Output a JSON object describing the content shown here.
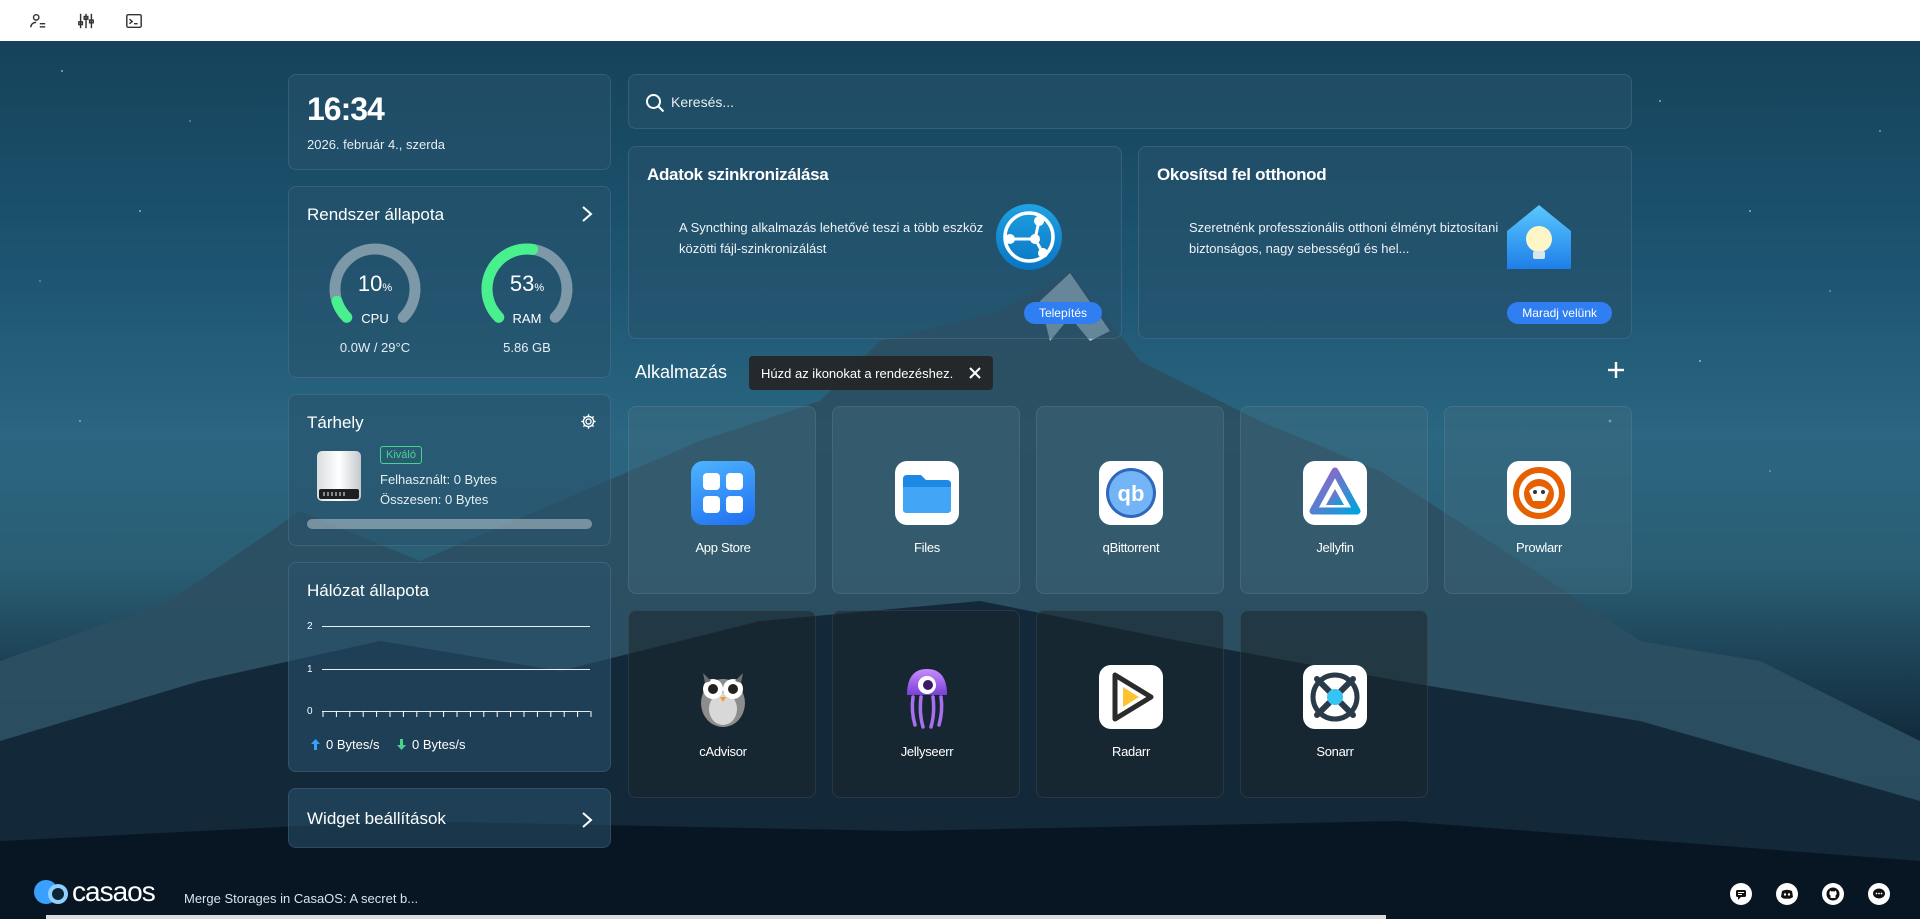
{
  "toolbar": {
    "icons": [
      "user-list-icon",
      "sliders-icon",
      "terminal-icon"
    ]
  },
  "clock": {
    "time": "16:34",
    "date": "2026. február 4., szerda"
  },
  "system": {
    "title": "Rendszer állapota",
    "cpu": {
      "value": "10",
      "unit": "%",
      "label": "CPU",
      "sub": "0.0W / 29°C",
      "percent": 10,
      "color": "#48f08e"
    },
    "ram": {
      "value": "53",
      "unit": "%",
      "label": "RAM",
      "sub": "5.86 GB",
      "percent": 53,
      "color": "#48f08e"
    }
  },
  "storage": {
    "title": "Tárhely",
    "badge": "Kiváló",
    "used": "Felhasznált: 0 Bytes",
    "total": "Összesen: 0 Bytes",
    "used_fraction": 0
  },
  "network": {
    "title": "Hálózat állapota",
    "y_ticks": [
      "2",
      "1",
      "0"
    ],
    "up": "0 Bytes/s",
    "down": "0 Bytes/s"
  },
  "widget_settings": {
    "title": "Widget beállítások"
  },
  "search": {
    "placeholder": "Keresés..."
  },
  "promos": [
    {
      "title": "Adatok szinkronizálása",
      "text": "A Syncthing alkalmazás lehetővé teszi a több eszköz közötti fájl-szinkronizálást",
      "button": "Telepítés",
      "icon": "syncthing-icon"
    },
    {
      "title": "Okosítsd fel otthonod",
      "text": "Szeretnénk professzionális otthoni élményt biztosítani biztonságos, nagy sebességű és hel...",
      "button": "Maradj velünk",
      "icon": "smart-home-icon"
    }
  ],
  "apps_section": {
    "title": "Alkalmazás",
    "tooltip": "Húzd az ikonokat a rendezéshez."
  },
  "apps": [
    {
      "name": "App Store",
      "icon": "app-store-icon"
    },
    {
      "name": "Files",
      "icon": "files-icon"
    },
    {
      "name": "qBittorrent",
      "icon": "qbittorrent-icon"
    },
    {
      "name": "Jellyfin",
      "icon": "jellyfin-icon"
    },
    {
      "name": "Prowlarr",
      "icon": "prowlarr-icon"
    },
    {
      "name": "cAdvisor",
      "icon": "cadvisor-icon"
    },
    {
      "name": "Jellyseerr",
      "icon": "jellyseerr-icon"
    },
    {
      "name": "Radarr",
      "icon": "radarr-icon"
    },
    {
      "name": "Sonarr",
      "icon": "sonarr-icon"
    }
  ],
  "footer": {
    "logo": "casaos",
    "news": "Merge Storages in CasaOS: A secret b...",
    "icons": [
      "chat-icon",
      "discord-icon",
      "github-icon",
      "message-icon"
    ]
  }
}
